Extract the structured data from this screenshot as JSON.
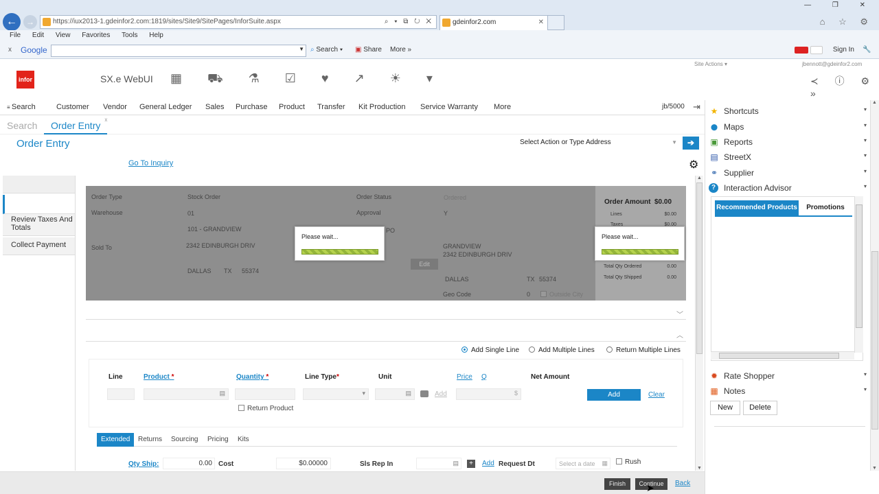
{
  "browser": {
    "url": "https://iux2013-1.gdeinfor2.com:1819/sites/Site9/SitePages/InforSuite.aspx",
    "url_tools": "⌕ ▾ ⧉ ↻ ✕",
    "tab_title": "gdeinfor2.com",
    "tab_close": "✕",
    "win_buttons": "— ❐ ✕",
    "toolbar_icons": "⌂ ☆ ⚙",
    "menu": [
      "File",
      "Edit",
      "View",
      "Favorites",
      "Tools",
      "Help"
    ],
    "google": {
      "close": "x",
      "logo": "Google",
      "search": "Search",
      "share": "Share",
      "more": "More »",
      "signin": "Sign In"
    }
  },
  "app": {
    "logo_text": "infor",
    "title": "SX.e WebUI",
    "site_actions": "Site Actions ▾",
    "user_email": "jbennott@gdeinfor2.com",
    "header_icons": "▦ ⛟ ⚗ ☑ ♥ ↗ ☀ ▾",
    "right_icons": "≺ ⓘ ⚙ »"
  },
  "nav": {
    "items": [
      "Search",
      "Customer",
      "Vendor",
      "General Ledger",
      "Sales",
      "Purchase",
      "Product",
      "Transfer",
      "Kit Production",
      "Service Warranty",
      "More"
    ],
    "user": "jb/5000",
    "logout": "⇥"
  },
  "subtabs": {
    "search": "Search",
    "order_entry": "Order Entry",
    "close": "x"
  },
  "page": {
    "title": "Order Entry",
    "action_placeholder": "Select Action or Type Address",
    "go_link": "Go To Inquiry"
  },
  "left_panel": {
    "taxes": "Review Taxes And Totals",
    "payment": "Collect Payment"
  },
  "order_header": {
    "order_type_label": "Order Type",
    "order_type": "Stock Order",
    "warehouse_label": "Warehouse",
    "warehouse": "01",
    "warehouse_name": "101 - GRANDVIEW",
    "sold_to_label": "Sold To",
    "sold_addr": "2342 EDINBURGH DRIV",
    "sold_city": "DALLAS",
    "sold_state": "TX",
    "sold_zip": "55374",
    "status_label": "Order Status",
    "status": "Ordered",
    "approval_label": "Approval",
    "approval": "Y",
    "po_label": "PO",
    "ship_name": "GRANDVIEW",
    "ship_addr": "2342 EDINBURGH DRIV",
    "ship_city": "DALLAS",
    "ship_state": "TX",
    "ship_zip": "55374",
    "edit": "Edit",
    "geo_label": "Geo Code",
    "geo": "0",
    "outside_city": "Outside City",
    "amount_label": "Order Amount",
    "amount": "$0.00",
    "lines_label": "Lines",
    "lines": "$0.00",
    "taxes_label": "Taxes",
    "taxes": "$0.00",
    "qty_ordered_label": "Total Qty Ordered",
    "qty_ordered": "0.00",
    "qty_shipped_label": "Total Qty Shipped",
    "qty_shipped": "0.00"
  },
  "wait": {
    "message": "Please wait..."
  },
  "line_entry": {
    "add_single": "Add Single Line",
    "add_multiple": "Add Multiple Lines",
    "return_multiple": "Return Multiple Lines",
    "col_line": "Line",
    "col_product": "Product",
    "col_quantity": "Quantity",
    "col_linetype": "Line Type",
    "col_unit": "Unit",
    "col_price": "Price",
    "col_q": "Q",
    "col_net": "Net Amount",
    "req": "*",
    "unit_add": "Add",
    "price_symbol": "$",
    "add_button": "Add",
    "clear": "Clear",
    "return_product": "Return Product"
  },
  "bottom_tabs": [
    "Extended",
    "Returns",
    "Sourcing",
    "Pricing",
    "Kits"
  ],
  "extended": {
    "qty_ship_label": "Qty Ship:",
    "qty_ship": "0.00",
    "cost_label": "Cost",
    "cost": "$0.00000",
    "slsrep_label": "Sls Rep In",
    "slsrep_add": "Add",
    "request_label": "Request Dt",
    "date_placeholder": "Select a date",
    "rush": "Rush"
  },
  "sidebar": {
    "items": [
      {
        "label": "Shortcuts",
        "icon": "★"
      },
      {
        "label": "Maps",
        "icon": "⬤"
      },
      {
        "label": "Reports",
        "icon": "▣"
      },
      {
        "label": "StreetX",
        "icon": "▤"
      },
      {
        "label": "Supplier",
        "icon": "⚭"
      },
      {
        "label": "Interaction Advisor",
        "icon": "?"
      }
    ],
    "ia_tabs": {
      "recommended": "Recommended Products",
      "promotions": "Promotions"
    },
    "rate_shopper": "Rate Shopper",
    "notes": "Notes",
    "new": "New",
    "delete": "Delete",
    "dd": "▾"
  },
  "footer": {
    "finish": "Finish",
    "continue": "Continue",
    "back": "Back"
  },
  "colors": {
    "accent": "#1b86c7",
    "brand": "#e2231a",
    "dim": "#8e8e8e"
  }
}
